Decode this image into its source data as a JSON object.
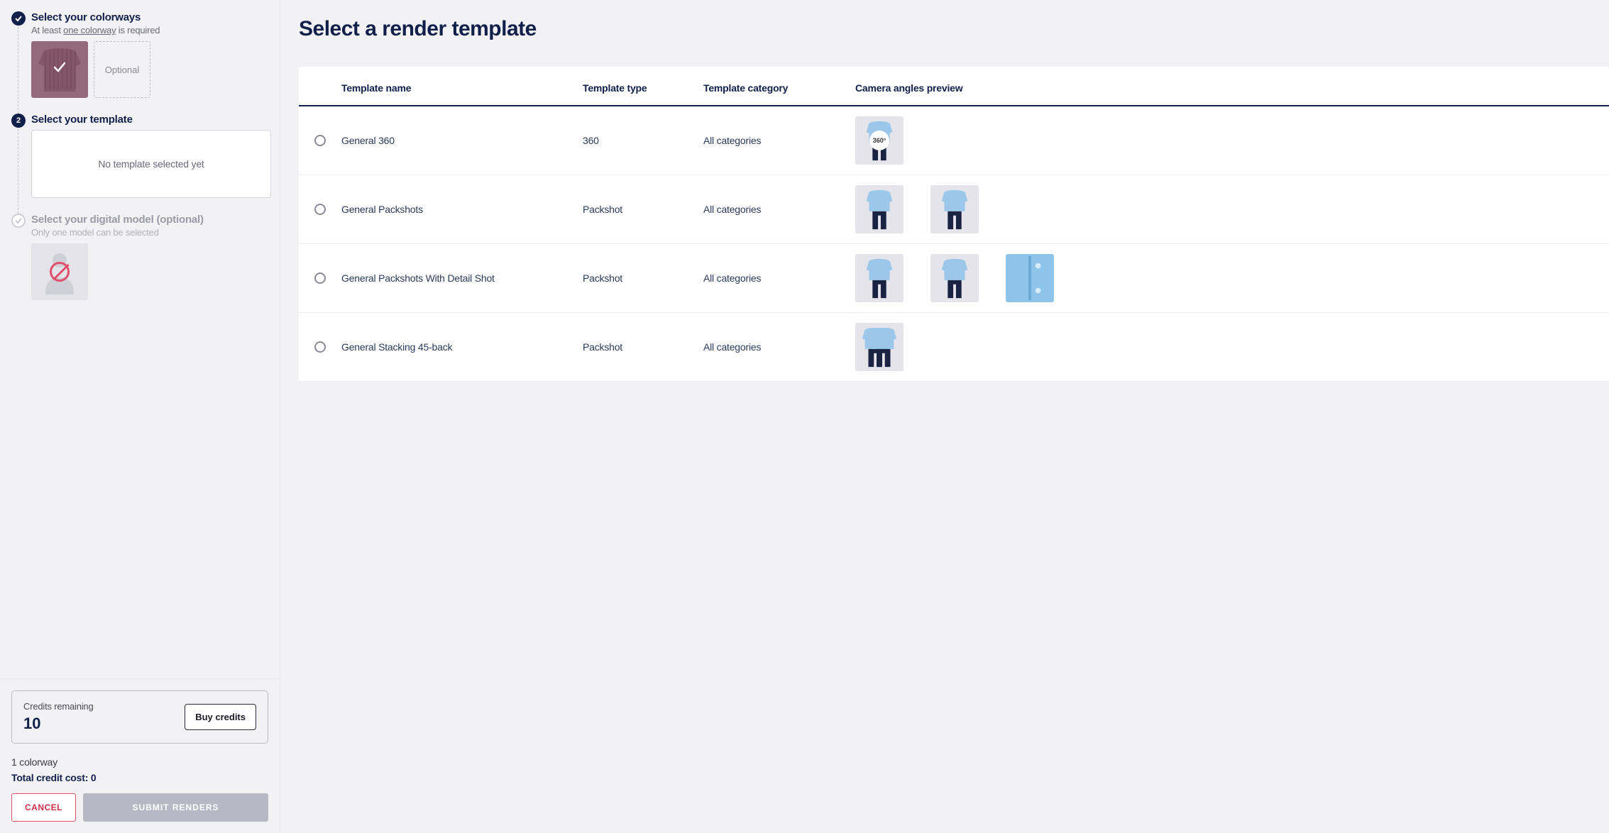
{
  "sidebar": {
    "steps": [
      {
        "title": "Select your colorways",
        "sub_pre": "At least ",
        "sub_underline": "one colorway",
        "sub_post": " is required",
        "optional_label": "Optional"
      },
      {
        "title": "Select your template",
        "empty_label": "No template selected yet"
      },
      {
        "title": "Select your digital model (optional)",
        "sub": "Only one model can be selected"
      }
    ]
  },
  "credits": {
    "label": "Credits remaining",
    "value": "10",
    "buy_label": "Buy credits"
  },
  "summary": {
    "colorway_line": "1 colorway",
    "cost_line": "Total credit cost: 0"
  },
  "actions": {
    "cancel": "CANCEL",
    "submit": "SUBMIT RENDERS"
  },
  "main": {
    "title": "Select a render template",
    "columns": {
      "name": "Template name",
      "type": "Template type",
      "category": "Template category",
      "preview": "Camera angles preview"
    },
    "rows": [
      {
        "name": "General 360",
        "type": "360",
        "category": "All categories",
        "previews": [
          "outfit-360"
        ]
      },
      {
        "name": "General Packshots",
        "type": "Packshot",
        "category": "All categories",
        "previews": [
          "outfit-front",
          "outfit-back"
        ]
      },
      {
        "name": "General Packshots With Detail Shot",
        "type": "Packshot",
        "category": "All categories",
        "previews": [
          "outfit-front",
          "outfit-back",
          "detail"
        ]
      },
      {
        "name": "General Stacking 45-back",
        "type": "Packshot",
        "category": "All categories",
        "previews": [
          "outfit-stack"
        ]
      }
    ],
    "badge360": "360°"
  }
}
